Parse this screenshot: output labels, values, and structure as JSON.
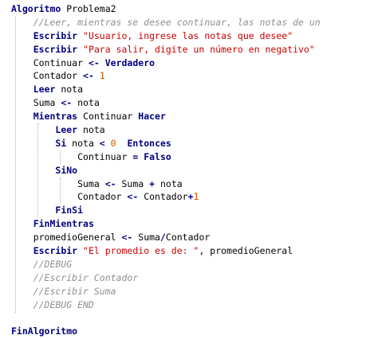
{
  "code": {
    "lines": [
      [
        {
          "t": "Algoritmo",
          "c": "kw"
        },
        {
          "t": " Problema2",
          "c": "id"
        }
      ],
      [
        {
          "t": "    //Leer, mientras se desee continuar, las notas de un",
          "c": "com"
        }
      ],
      [
        {
          "t": "    ",
          "c": "id"
        },
        {
          "t": "Escribir",
          "c": "kw"
        },
        {
          "t": " ",
          "c": "id"
        },
        {
          "t": "\"Usuario, ingrese las notas que desee\"",
          "c": "str"
        }
      ],
      [
        {
          "t": "    ",
          "c": "id"
        },
        {
          "t": "Escribir",
          "c": "kw"
        },
        {
          "t": " ",
          "c": "id"
        },
        {
          "t": "\"Para salir, digite un número en negativo\"",
          "c": "str"
        }
      ],
      [
        {
          "t": "    Continuar ",
          "c": "id"
        },
        {
          "t": "<-",
          "c": "kw"
        },
        {
          "t": " ",
          "c": "id"
        },
        {
          "t": "Verdadero",
          "c": "kw"
        }
      ],
      [
        {
          "t": "    Contador ",
          "c": "id"
        },
        {
          "t": "<-",
          "c": "kw"
        },
        {
          "t": " ",
          "c": "id"
        },
        {
          "t": "1",
          "c": "num"
        }
      ],
      [
        {
          "t": "    ",
          "c": "id"
        },
        {
          "t": "Leer",
          "c": "kw"
        },
        {
          "t": " nota",
          "c": "id"
        }
      ],
      [
        {
          "t": "    Suma ",
          "c": "id"
        },
        {
          "t": "<-",
          "c": "kw"
        },
        {
          "t": " nota",
          "c": "id"
        }
      ],
      [
        {
          "t": "    ",
          "c": "id"
        },
        {
          "t": "Mientras",
          "c": "kw"
        },
        {
          "t": " Continuar ",
          "c": "id"
        },
        {
          "t": "Hacer",
          "c": "kw"
        }
      ],
      [
        {
          "t": "        ",
          "c": "id"
        },
        {
          "t": "Leer",
          "c": "kw"
        },
        {
          "t": " nota",
          "c": "id"
        }
      ],
      [
        {
          "t": "        ",
          "c": "id"
        },
        {
          "t": "Si",
          "c": "kw"
        },
        {
          "t": " nota ",
          "c": "id"
        },
        {
          "t": "<",
          "c": "kw"
        },
        {
          "t": " ",
          "c": "id"
        },
        {
          "t": "0",
          "c": "num"
        },
        {
          "t": "  ",
          "c": "id"
        },
        {
          "t": "Entonces",
          "c": "kw"
        }
      ],
      [
        {
          "t": "            Continuar ",
          "c": "id"
        },
        {
          "t": "=",
          "c": "kw"
        },
        {
          "t": " ",
          "c": "id"
        },
        {
          "t": "Falso",
          "c": "kw"
        }
      ],
      [
        {
          "t": "        ",
          "c": "id"
        },
        {
          "t": "SiNo",
          "c": "kw"
        }
      ],
      [
        {
          "t": "            Suma ",
          "c": "id"
        },
        {
          "t": "<-",
          "c": "kw"
        },
        {
          "t": " Suma ",
          "c": "id"
        },
        {
          "t": "+",
          "c": "kw"
        },
        {
          "t": " nota",
          "c": "id"
        }
      ],
      [
        {
          "t": "            Contador ",
          "c": "id"
        },
        {
          "t": "<-",
          "c": "kw"
        },
        {
          "t": " Contador",
          "c": "id"
        },
        {
          "t": "+",
          "c": "kw"
        },
        {
          "t": "1",
          "c": "num"
        }
      ],
      [
        {
          "t": "        ",
          "c": "id"
        },
        {
          "t": "FinSi",
          "c": "kw"
        }
      ],
      [
        {
          "t": "    ",
          "c": "id"
        },
        {
          "t": "FinMientras",
          "c": "kw"
        }
      ],
      [
        {
          "t": "    promedioGeneral ",
          "c": "id"
        },
        {
          "t": "<-",
          "c": "kw"
        },
        {
          "t": " Suma",
          "c": "id"
        },
        {
          "t": "/",
          "c": "kw"
        },
        {
          "t": "Contador",
          "c": "id"
        }
      ],
      [
        {
          "t": "    ",
          "c": "id"
        },
        {
          "t": "Escribir",
          "c": "kw"
        },
        {
          "t": " ",
          "c": "id"
        },
        {
          "t": "\"El promedio es de: \"",
          "c": "str"
        },
        {
          "t": ", promedioGeneral",
          "c": "id"
        }
      ],
      [
        {
          "t": "    //DEBUG",
          "c": "com"
        }
      ],
      [
        {
          "t": "    //Escribir Contador",
          "c": "com"
        }
      ],
      [
        {
          "t": "    //Escribir Suma",
          "c": "com"
        }
      ],
      [
        {
          "t": "    //DEBUG END",
          "c": "com"
        }
      ],
      [],
      [
        {
          "t": "FinAlgoritmo",
          "c": "kw"
        }
      ]
    ]
  },
  "colors": {
    "keyword": "#00007f",
    "string": "#cc0000",
    "number": "#cc5500",
    "comment": "#8f8f8f",
    "identifier": "#000000",
    "background": "#ffffff"
  }
}
